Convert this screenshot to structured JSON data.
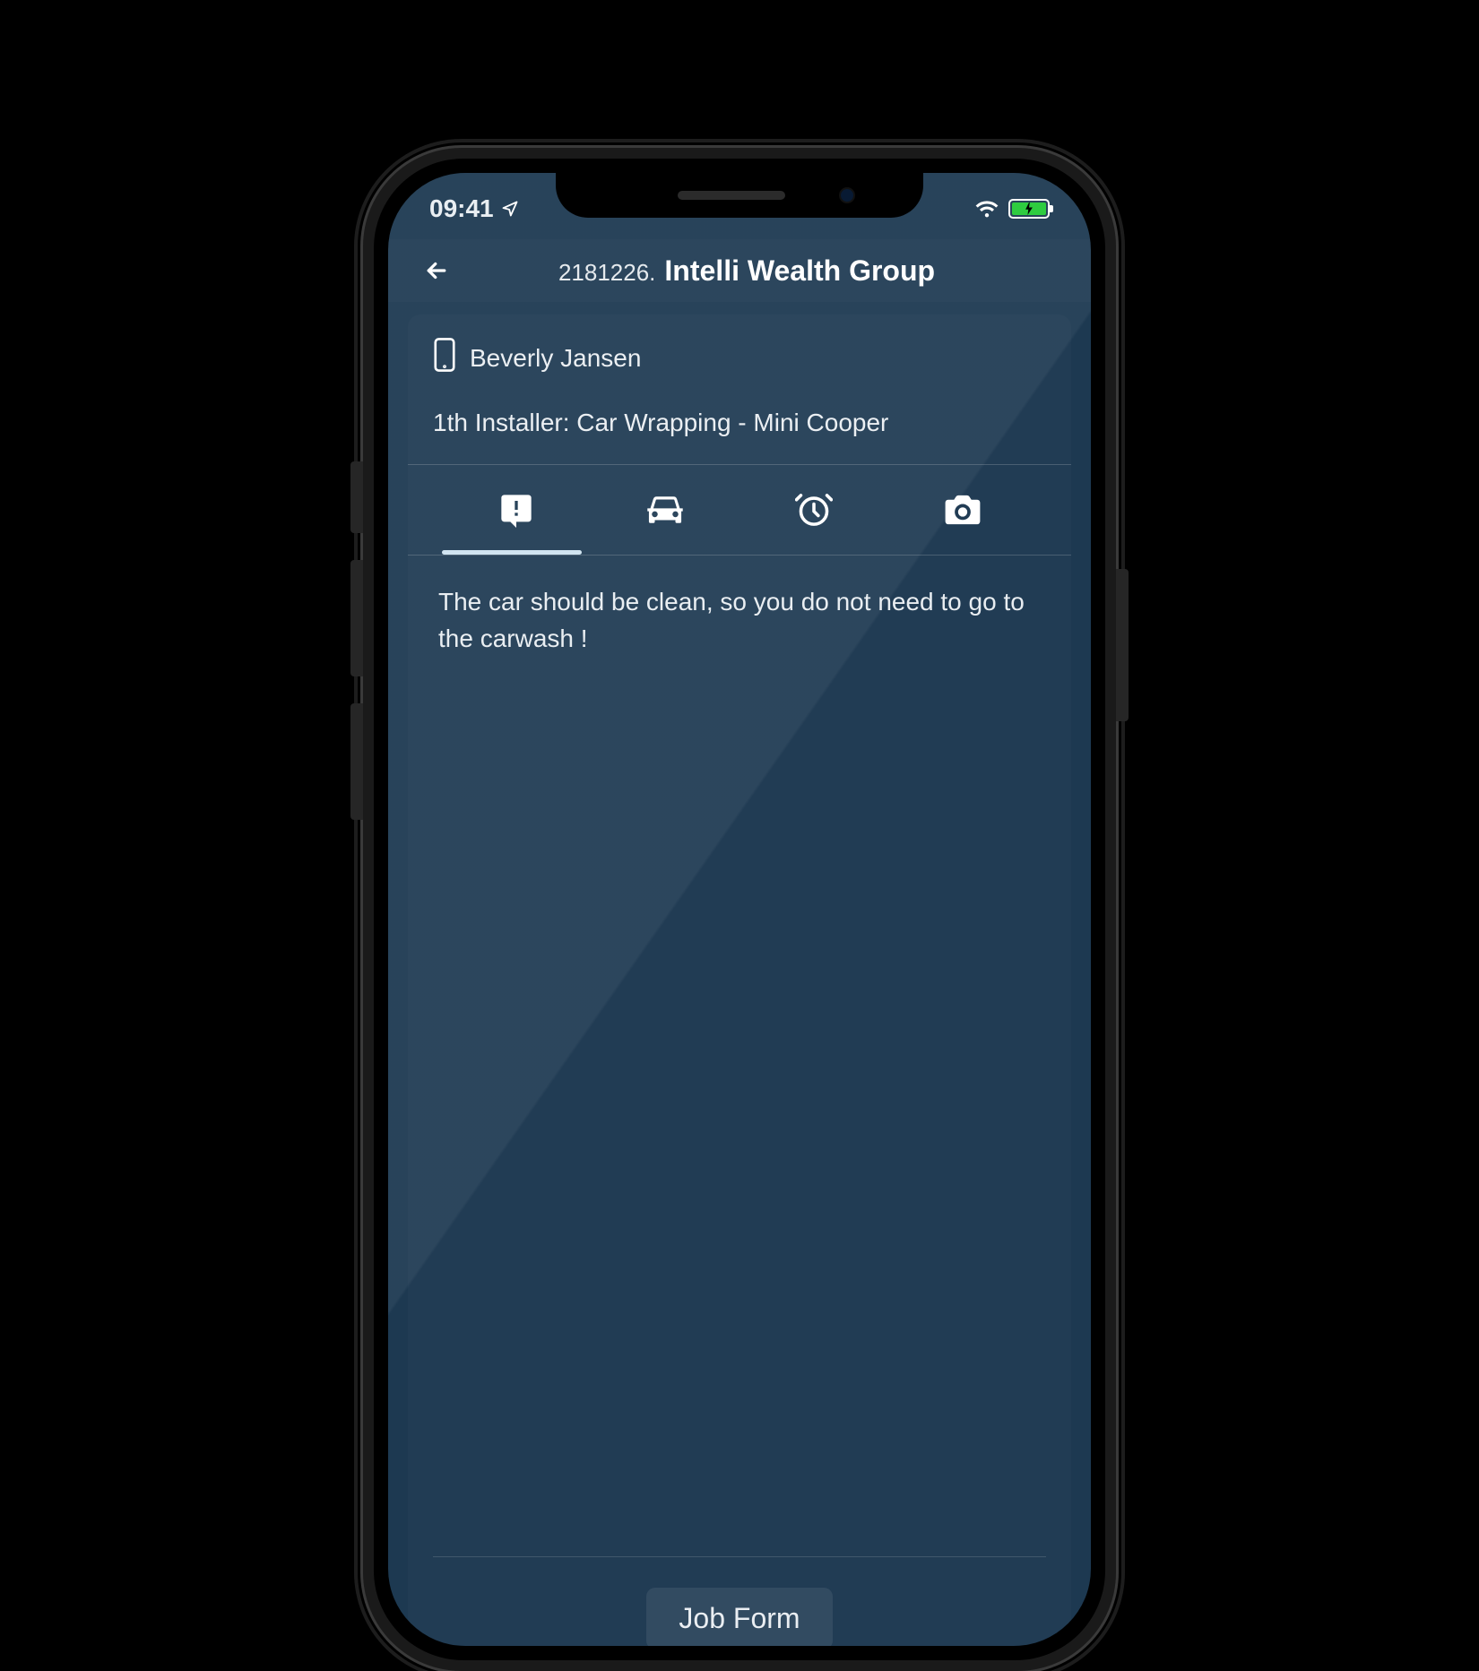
{
  "status": {
    "time": "09:41"
  },
  "header": {
    "job_id": "2181226.",
    "company_name": "Intelli Wealth Group"
  },
  "card": {
    "contact_name": "Beverly Jansen",
    "job_subtitle": "1th Installer: Car Wrapping - Mini Cooper",
    "tabs": {
      "active_index": 0,
      "items": [
        {
          "icon": "announcement-icon"
        },
        {
          "icon": "car-icon"
        },
        {
          "icon": "alarm-icon"
        },
        {
          "icon": "camera-icon"
        }
      ]
    },
    "note_text": "The car should be clean, so you do not need to go to the carwash !",
    "job_form_label": "Job Form"
  }
}
